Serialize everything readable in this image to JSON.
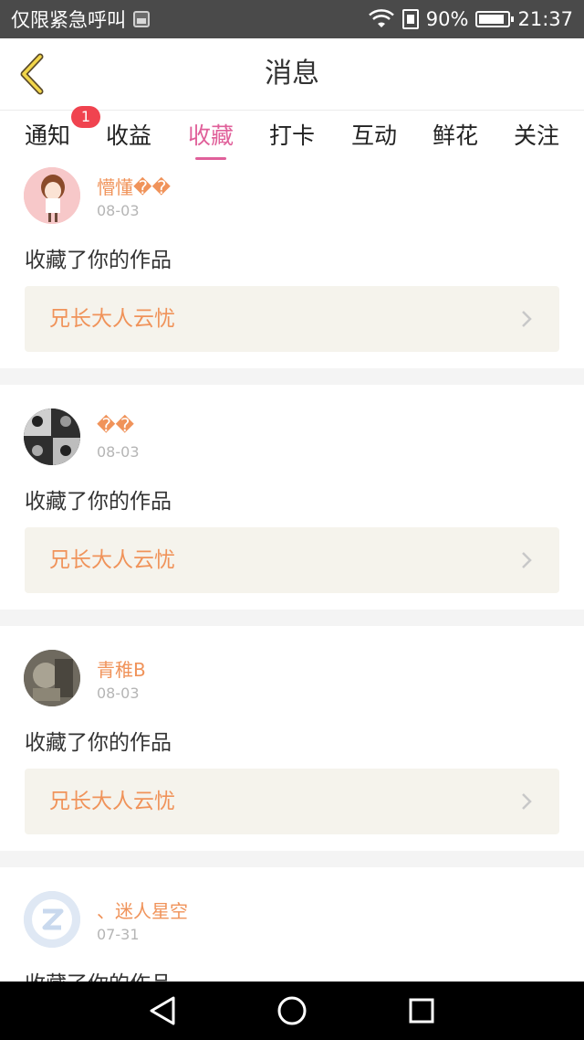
{
  "status_bar": {
    "left_text": "仅限紧急呼叫",
    "battery": "90%",
    "battery_level": 0.9,
    "time": "21:37"
  },
  "header": {
    "title": "消息",
    "back_icon": "chevron-left-icon"
  },
  "tabs": [
    {
      "label": "通知",
      "badge": "1"
    },
    {
      "label": "收益"
    },
    {
      "label": "收藏",
      "active": true
    },
    {
      "label": "打卡"
    },
    {
      "label": "互动"
    },
    {
      "label": "鲜花"
    },
    {
      "label": "关注"
    }
  ],
  "items": [
    {
      "username": "懵懂��",
      "date": "08-03",
      "action": "收藏了你的作品",
      "work": "兄长大人云忧"
    },
    {
      "username": "��",
      "date": "08-03",
      "action": "收藏了你的作品",
      "work": "兄长大人云忧"
    },
    {
      "username": "青稚B",
      "date": "08-03",
      "action": "收藏了你的作品",
      "work": "兄长大人云忧"
    },
    {
      "username": "、迷人星空",
      "date": "07-31",
      "action": "收藏了你的作品",
      "work": ""
    }
  ],
  "colors": {
    "accent": "#e0609a",
    "name": "#f0935a",
    "badge": "#f0434f",
    "link_bg": "#f5f3ec"
  },
  "nav": {
    "back": "triangle-back-icon",
    "home": "circle-home-icon",
    "recent": "square-recent-icon"
  }
}
